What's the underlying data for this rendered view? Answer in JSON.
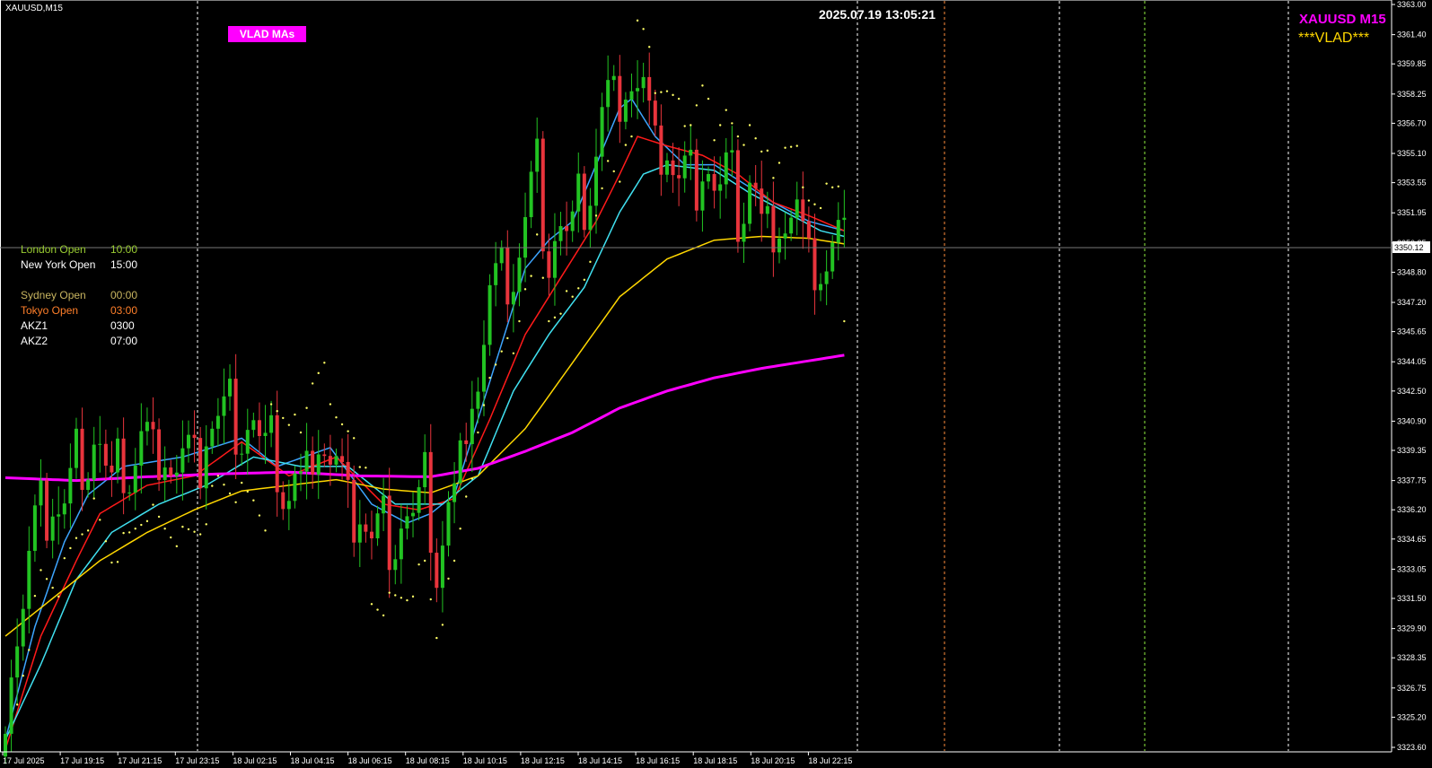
{
  "window": {
    "symbol_timeframe": "XAUUSD,M15",
    "timestamp": "2025.07.19 13:05:21",
    "indicator_badge": "VLAD MAs",
    "symbol_title": "XAUUSD M15",
    "tag": "***VLAD***"
  },
  "sessions": [
    {
      "name": "London Open",
      "time": "10:00",
      "color": "#9acd32"
    },
    {
      "name": "New York Open",
      "time": "15:00",
      "color": "#ffffff"
    },
    {
      "name": "Sydney Open",
      "time": "00:00",
      "color": "#c8b560"
    },
    {
      "name": "Tokyo Open",
      "time": "03:00",
      "color": "#ff7f2a"
    },
    {
      "name": "AKZ1",
      "time": "0300",
      "color": "#ffffff"
    },
    {
      "name": "AKZ2",
      "time": "07:00",
      "color": "#ffffff"
    }
  ],
  "colors": {
    "background": "#000000",
    "bull": "#22c322",
    "bear": "#e8343c",
    "ema_fast": "#3da5ff",
    "ema_red": "#ff1a1a",
    "ema_cyan": "#40e0f0",
    "ma_yellow": "#ffd700",
    "ma_magenta": "#ff00ff",
    "psar": "#ffff66"
  },
  "chart_data": {
    "type": "candlestick",
    "y_axis": {
      "min": 3323.6,
      "max": 3363.0,
      "ticks": [
        "3363.00",
        "3361.40",
        "3359.85",
        "3358.25",
        "3356.70",
        "3355.10",
        "3353.55",
        "3351.95",
        "3350.35",
        "3348.80",
        "3347.20",
        "3345.65",
        "3344.05",
        "3342.50",
        "3340.90",
        "3339.35",
        "3337.75",
        "3336.20",
        "3334.65",
        "3333.05",
        "3331.50",
        "3329.90",
        "3328.35",
        "3326.75",
        "3325.20",
        "3323.60"
      ]
    },
    "x_axis": {
      "ticks": [
        "17 Jul 2025",
        "17 Jul 19:15",
        "17 Jul 21:15",
        "17 Jul 23:15",
        "18 Jul 02:15",
        "18 Jul 04:15",
        "18 Jul 06:15",
        "18 Jul 08:15",
        "18 Jul 10:15",
        "18 Jul 12:15",
        "18 Jul 14:15",
        "18 Jul 16:15",
        "18 Jul 18:15",
        "18 Jul 20:15",
        "18 Jul 22:15"
      ]
    },
    "current_price": "3350.12",
    "anchors": [
      [
        0,
        3326.0
      ],
      [
        3,
        3331.5
      ],
      [
        6,
        3336.5
      ],
      [
        9,
        3336.0
      ],
      [
        12,
        3338.5
      ],
      [
        15,
        3340.0
      ],
      [
        18,
        3337.5
      ],
      [
        21,
        3338.5
      ],
      [
        24,
        3340.0
      ],
      [
        27,
        3339.0
      ],
      [
        30,
        3338.5
      ],
      [
        33,
        3339.0
      ],
      [
        36,
        3341.5
      ],
      [
        39,
        3341.0
      ],
      [
        42,
        3340.5
      ],
      [
        45,
        3339.0
      ],
      [
        48,
        3337.0
      ],
      [
        50,
        3337.5
      ],
      [
        52,
        3339.5
      ],
      [
        54,
        3340.0
      ],
      [
        56,
        3338.0
      ],
      [
        59,
        3336.0
      ],
      [
        62,
        3335.0
      ],
      [
        65,
        3335.0
      ],
      [
        68,
        3335.5
      ],
      [
        71,
        3337.0
      ],
      [
        73,
        3333.5
      ],
      [
        74,
        3334.5
      ],
      [
        76,
        3337.0
      ],
      [
        78,
        3341.0
      ],
      [
        80,
        3343.5
      ],
      [
        82,
        3347.0
      ],
      [
        84,
        3349.0
      ],
      [
        86,
        3348.0
      ],
      [
        88,
        3352.0
      ],
      [
        90,
        3354.0
      ],
      [
        92,
        3350.0
      ],
      [
        94,
        3351.0
      ],
      [
        96,
        3351.0
      ],
      [
        98,
        3352.5
      ],
      [
        100,
        3355.0
      ],
      [
        102,
        3358.5
      ],
      [
        104,
        3358.0
      ],
      [
        106,
        3359.5
      ],
      [
        108,
        3358.0
      ],
      [
        110,
        3355.5
      ],
      [
        112,
        3355.0
      ],
      [
        114,
        3354.0
      ],
      [
        116,
        3353.5
      ],
      [
        118,
        3355.0
      ],
      [
        120,
        3353.0
      ],
      [
        122,
        3354.0
      ],
      [
        124,
        3352.0
      ],
      [
        126,
        3353.5
      ],
      [
        128,
        3351.5
      ],
      [
        130,
        3351.0
      ],
      [
        132,
        3352.0
      ],
      [
        134,
        3351.5
      ],
      [
        136,
        3349.5
      ],
      [
        138,
        3348.5
      ],
      [
        140,
        3350.5
      ],
      [
        142,
        3350.0
      ]
    ],
    "moving_averages": [
      {
        "label": "EMA fast (blue)",
        "anchors": [
          [
            0,
            3324.0
          ],
          [
            5,
            3330.0
          ],
          [
            10,
            3334.5
          ],
          [
            14,
            3337.0
          ],
          [
            20,
            3338.5
          ],
          [
            30,
            3339.0
          ],
          [
            40,
            3340.0
          ],
          [
            46,
            3338.5
          ],
          [
            55,
            3339.5
          ],
          [
            62,
            3336.5
          ],
          [
            68,
            3335.5
          ],
          [
            72,
            3336.0
          ],
          [
            76,
            3337.0
          ],
          [
            80,
            3341.0
          ],
          [
            84,
            3345.0
          ],
          [
            88,
            3349.0
          ],
          [
            92,
            3350.5
          ],
          [
            96,
            3351.5
          ],
          [
            100,
            3354.5
          ],
          [
            104,
            3357.5
          ],
          [
            106,
            3358.0
          ],
          [
            110,
            3356.0
          ],
          [
            115,
            3354.5
          ],
          [
            120,
            3354.5
          ],
          [
            125,
            3353.5
          ],
          [
            130,
            3352.5
          ],
          [
            136,
            3351.5
          ],
          [
            142,
            3351.0
          ]
        ]
      },
      {
        "label": "EMA red",
        "anchors": [
          [
            0,
            3323.5
          ],
          [
            6,
            3329.5
          ],
          [
            12,
            3333.5
          ],
          [
            16,
            3336.0
          ],
          [
            24,
            3337.5
          ],
          [
            32,
            3338.0
          ],
          [
            40,
            3339.8
          ],
          [
            48,
            3338.0
          ],
          [
            56,
            3339.0
          ],
          [
            64,
            3336.5
          ],
          [
            70,
            3336.2
          ],
          [
            76,
            3336.8
          ],
          [
            82,
            3341.0
          ],
          [
            88,
            3345.5
          ],
          [
            94,
            3348.5
          ],
          [
            100,
            3351.5
          ],
          [
            104,
            3354.0
          ],
          [
            107,
            3356.0
          ],
          [
            112,
            3355.5
          ],
          [
            118,
            3355.0
          ],
          [
            124,
            3354.0
          ],
          [
            130,
            3352.5
          ],
          [
            136,
            3351.8
          ],
          [
            142,
            3351.0
          ]
        ]
      },
      {
        "label": "EMA cyan",
        "anchors": [
          [
            0,
            3324.0
          ],
          [
            6,
            3328.0
          ],
          [
            12,
            3332.5
          ],
          [
            18,
            3335.0
          ],
          [
            26,
            3336.5
          ],
          [
            34,
            3337.5
          ],
          [
            42,
            3339.0
          ],
          [
            50,
            3338.5
          ],
          [
            58,
            3338.5
          ],
          [
            66,
            3336.5
          ],
          [
            74,
            3336.5
          ],
          [
            80,
            3338.0
          ],
          [
            86,
            3342.5
          ],
          [
            92,
            3345.5
          ],
          [
            98,
            3348.0
          ],
          [
            104,
            3352.0
          ],
          [
            108,
            3354.0
          ],
          [
            112,
            3354.5
          ],
          [
            120,
            3354.2
          ],
          [
            126,
            3353.0
          ],
          [
            132,
            3352.0
          ],
          [
            138,
            3351.0
          ],
          [
            142,
            3350.7
          ]
        ]
      },
      {
        "label": "MA yellow",
        "anchors": [
          [
            0,
            3329.5
          ],
          [
            8,
            3331.5
          ],
          [
            16,
            3333.5
          ],
          [
            24,
            3335.0
          ],
          [
            32,
            3336.2
          ],
          [
            40,
            3337.2
          ],
          [
            48,
            3337.5
          ],
          [
            56,
            3337.8
          ],
          [
            64,
            3337.3
          ],
          [
            72,
            3337.1
          ],
          [
            80,
            3338.0
          ],
          [
            88,
            3340.5
          ],
          [
            96,
            3344.0
          ],
          [
            104,
            3347.5
          ],
          [
            112,
            3349.5
          ],
          [
            120,
            3350.5
          ],
          [
            128,
            3350.7
          ],
          [
            136,
            3350.6
          ],
          [
            142,
            3350.3
          ]
        ]
      },
      {
        "label": "MA magenta",
        "anchors": [
          [
            0,
            3337.9
          ],
          [
            12,
            3337.75
          ],
          [
            24,
            3337.95
          ],
          [
            36,
            3338.1
          ],
          [
            48,
            3338.2
          ],
          [
            60,
            3338.0
          ],
          [
            72,
            3337.95
          ],
          [
            80,
            3338.4
          ],
          [
            88,
            3339.3
          ],
          [
            96,
            3340.3
          ],
          [
            104,
            3341.6
          ],
          [
            112,
            3342.5
          ],
          [
            120,
            3343.2
          ],
          [
            128,
            3343.7
          ],
          [
            136,
            3344.1
          ],
          [
            142,
            3344.4
          ]
        ]
      }
    ]
  }
}
